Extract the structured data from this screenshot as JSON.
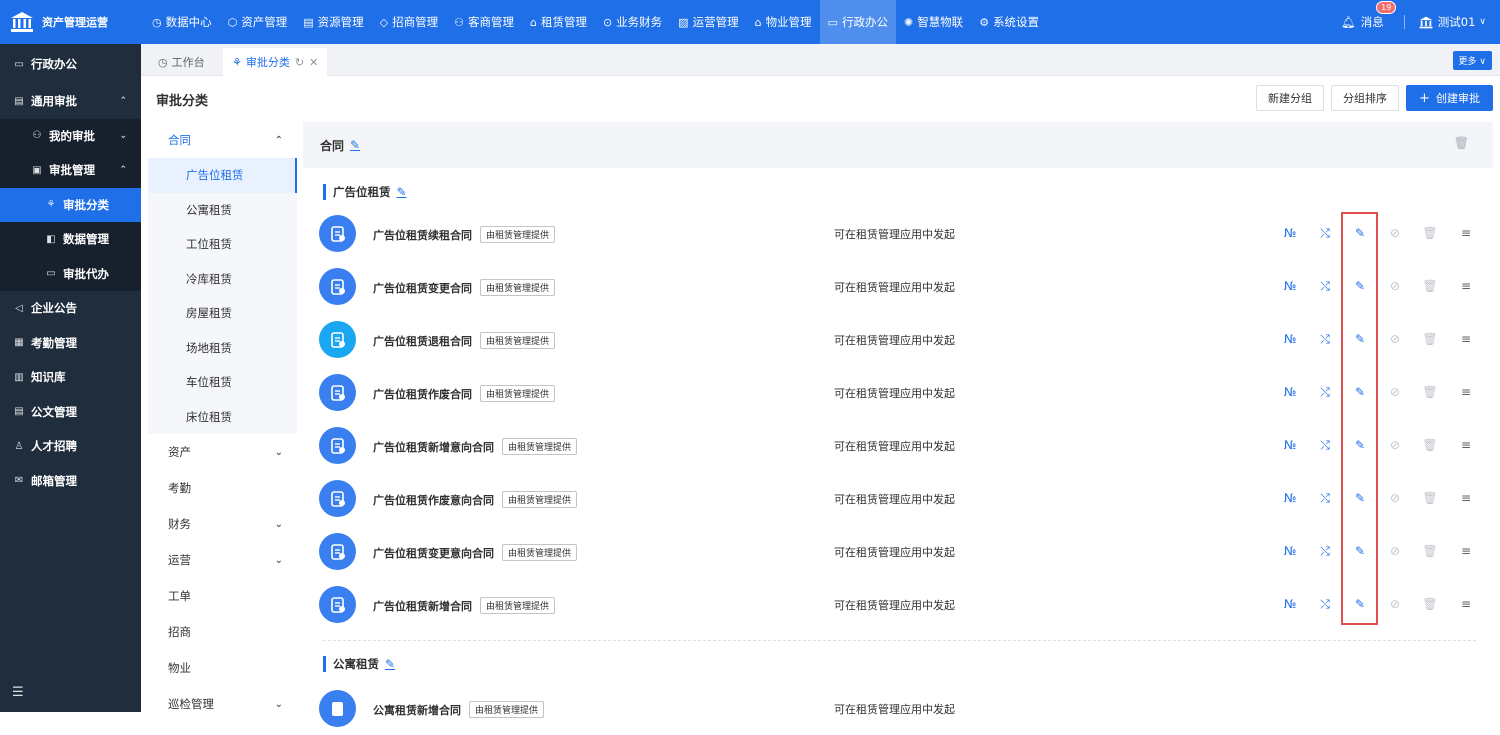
{
  "brand": {
    "name": "资产管理运营"
  },
  "topnav": [
    {
      "label": "数据中心",
      "icon": "clock-icon"
    },
    {
      "label": "资产管理",
      "icon": "cube-icon"
    },
    {
      "label": "资源管理",
      "icon": "building-icon"
    },
    {
      "label": "招商管理",
      "icon": "tag-icon"
    },
    {
      "label": "客商管理",
      "icon": "group-icon"
    },
    {
      "label": "租赁管理",
      "icon": "house-icon"
    },
    {
      "label": "业务财务",
      "icon": "coin-icon"
    },
    {
      "label": "运营管理",
      "icon": "chart-icon"
    },
    {
      "label": "物业管理",
      "icon": "home-icon"
    },
    {
      "label": "行政办公",
      "icon": "monitor-icon",
      "active": true
    },
    {
      "label": "智慧物联",
      "icon": "iot-icon"
    },
    {
      "label": "系统设置",
      "icon": "gear-icon"
    }
  ],
  "topright": {
    "messages": "消息",
    "message_count": "19",
    "user": "测试01"
  },
  "sidebar": {
    "title": "行政办公",
    "items": [
      {
        "label": "通用审批",
        "level": 0
      },
      {
        "label": "我的审批",
        "level": 1
      },
      {
        "label": "审批管理",
        "level": 1
      },
      {
        "label": "审批分类",
        "level": 2,
        "active": true
      },
      {
        "label": "数据管理",
        "level": 2
      },
      {
        "label": "审批代办",
        "level": 2
      },
      {
        "label": "企业公告",
        "level": 0
      },
      {
        "label": "考勤管理",
        "level": 0
      },
      {
        "label": "知识库",
        "level": 0
      },
      {
        "label": "公文管理",
        "level": 0
      },
      {
        "label": "人才招聘",
        "level": 0
      },
      {
        "label": "邮箱管理",
        "level": 0
      }
    ]
  },
  "tabs": {
    "workbench": "工作台",
    "current": "审批分类",
    "more": "更多"
  },
  "page": {
    "title": "审批分类",
    "new_group": "新建分组",
    "sort_group": "分组排序",
    "create": "创建审批"
  },
  "categories": {
    "open_group": "合同",
    "items": [
      "广告位租赁",
      "公寓租赁",
      "工位租赁",
      "冷库租赁",
      "房屋租赁",
      "场地租赁",
      "车位租赁",
      "床位租赁"
    ],
    "active_item": "广告位租赁",
    "groups": [
      {
        "label": "资产",
        "expandable": true
      },
      {
        "label": "考勤",
        "expandable": false
      },
      {
        "label": "财务",
        "expandable": true
      },
      {
        "label": "运营",
        "expandable": true
      },
      {
        "label": "工单",
        "expandable": false
      },
      {
        "label": "招商",
        "expandable": false
      },
      {
        "label": "物业",
        "expandable": false
      },
      {
        "label": "巡检管理",
        "expandable": true
      }
    ]
  },
  "content": {
    "group_title": "合同",
    "section1": "广告位租赁",
    "section2": "公寓租赁",
    "provided_tag": "由租赁管理提供",
    "desc": "可在租赁管理应用中发起",
    "rows": [
      {
        "name": "广告位租赁续租合同",
        "icon": "renew-doc-icon"
      },
      {
        "name": "广告位租赁变更合同",
        "icon": "change-doc-icon"
      },
      {
        "name": "广告位租赁退租合同",
        "icon": "return-doc-icon",
        "cyan": true
      },
      {
        "name": "广告位租赁作废合同",
        "icon": "void-doc-icon"
      },
      {
        "name": "广告位租赁新增意向合同",
        "icon": "add-doc-icon"
      },
      {
        "name": "广告位租赁作废意向合同",
        "icon": "void-doc-icon"
      },
      {
        "name": "广告位租赁变更意向合同",
        "icon": "change-doc-icon"
      },
      {
        "name": "广告位租赁新增合同",
        "icon": "add-doc-icon"
      }
    ],
    "partial_row": {
      "name": "公寓租赁新增合同"
    }
  },
  "action_glyphs": {
    "number": "№",
    "flow": "⤭",
    "edit": "✎",
    "disable": "⊘",
    "delete": "🗑",
    "menu": "≡"
  }
}
